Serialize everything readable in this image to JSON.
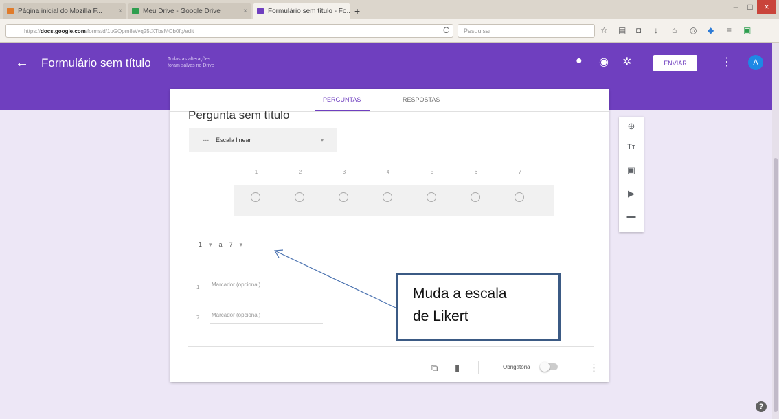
{
  "browser": {
    "tabs": [
      {
        "title": "Página inicial do Mozilla F...",
        "close": "×",
        "favicon_color": "#e07b2a"
      },
      {
        "title": "Meu Drive - Google Drive",
        "close": "×",
        "favicon_color": "#2e9e4f"
      },
      {
        "title": "Formulário sem título - Fo...",
        "close": "×",
        "favicon_color": "#6f3fbf"
      }
    ],
    "new_tab": "+",
    "window_minimize": "–",
    "window_maximize": "□",
    "window_close": "×",
    "url_domain": "docs.google.com",
    "url_prefix": "https://",
    "url_rest": "/forms/d/1uGQpm8Wvq25tXTbsMOb0fg/edit",
    "reload": "C",
    "search_placeholder": "Pesquisar"
  },
  "header": {
    "back_icon": "←",
    "title": "Formulário sem título",
    "save_note": "Todas as alterações foram salvas no Drive",
    "palette_icon": "●",
    "preview_icon": "◉",
    "settings_icon": "✲",
    "send_label": "ENVIAR",
    "more_icon": "⋮",
    "avatar_letter": "A"
  },
  "tabs": {
    "questions": "PERGUNTAS",
    "responses": "RESPOSTAS"
  },
  "question": {
    "title": "Pergunta sem título",
    "type_icon": "---",
    "type_label": "Escala linear",
    "type_dropdown": "▾",
    "scale_labels": [
      "1",
      "2",
      "3",
      "4",
      "5",
      "6",
      "7"
    ],
    "range_from": "1",
    "range_from_dd": "▾",
    "range_sep": "a",
    "range_to": "7",
    "range_to_dd": "▾",
    "label1_index": "1",
    "label1_placeholder": "Marcador (opcional)",
    "label2_index": "7",
    "label2_placeholder": "Marcador (opcional)",
    "required_label": "Obrigatória",
    "copy_icon": "⧉",
    "delete_icon": "▮",
    "more_icon": "⋮"
  },
  "sidebar": {
    "add_icon": "⊕",
    "title_icon": "Tт",
    "image_icon": "▣",
    "video_icon": "▶",
    "section_icon": "▬"
  },
  "help_icon": "?",
  "annotation": {
    "line1": "Muda a escala",
    "line2": "de Likert"
  }
}
